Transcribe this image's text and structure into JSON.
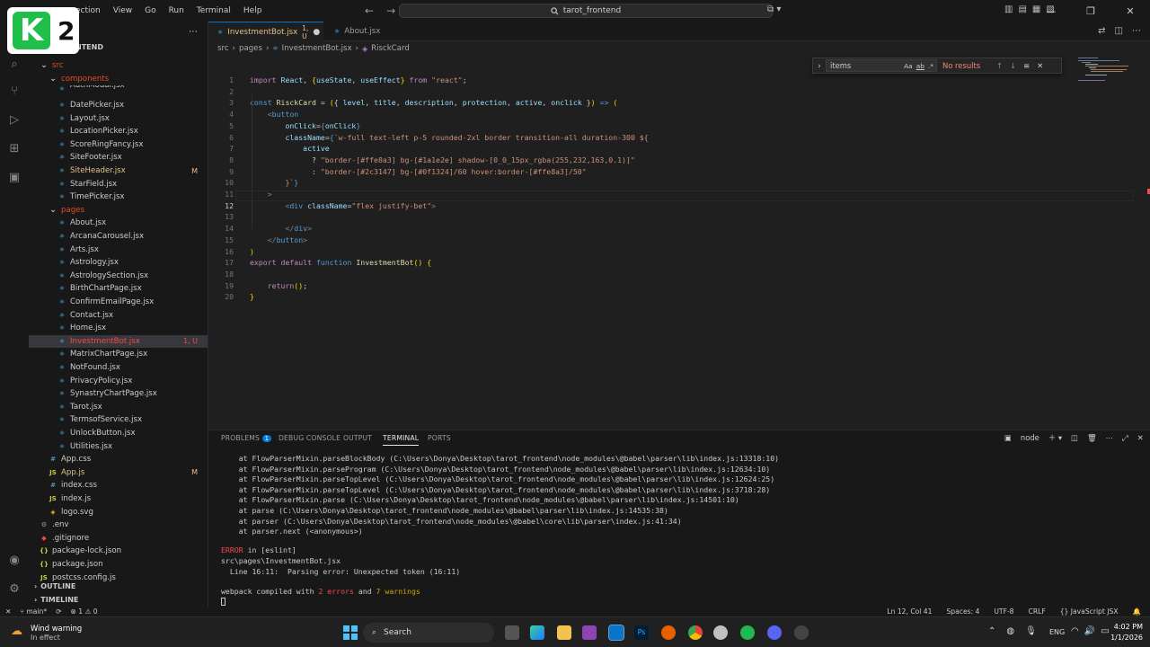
{
  "menu": [
    "ection",
    "View",
    "Go",
    "Run",
    "Terminal",
    "Help"
  ],
  "logo_text": "K",
  "logo_number": "2",
  "command_center": "tarot_frontend",
  "explorer": {
    "header": "NTEND",
    "rows": [
      {
        "label": "src",
        "type": "folder",
        "open": true,
        "indent": 1,
        "color": "#e34c26"
      },
      {
        "label": "components",
        "type": "folder",
        "open": true,
        "indent": 2,
        "color": "#e34c26"
      },
      {
        "label": "AuthModal.jsx",
        "type": "jsx",
        "indent": 3,
        "partial": true
      },
      {
        "label": "DatePicker.jsx",
        "type": "jsx",
        "indent": 3
      },
      {
        "label": "Layout.jsx",
        "type": "jsx",
        "indent": 3
      },
      {
        "label": "LocationPicker.jsx",
        "type": "jsx",
        "indent": 3
      },
      {
        "label": "ScoreRingFancy.jsx",
        "type": "jsx",
        "indent": 3
      },
      {
        "label": "SiteFooter.jsx",
        "type": "jsx",
        "indent": 3
      },
      {
        "label": "SiteHeader.jsx",
        "type": "jsx",
        "indent": 3,
        "status": "M",
        "modified": true
      },
      {
        "label": "StarField.jsx",
        "type": "jsx",
        "indent": 3
      },
      {
        "label": "TimePicker.jsx",
        "type": "jsx",
        "indent": 3
      },
      {
        "label": "pages",
        "type": "folder",
        "open": true,
        "indent": 2,
        "color": "#e34c26"
      },
      {
        "label": "About.jsx",
        "type": "jsx",
        "indent": 3
      },
      {
        "label": "ArcanaCarousel.jsx",
        "type": "jsx",
        "indent": 3
      },
      {
        "label": "Arts.jsx",
        "type": "jsx",
        "indent": 3
      },
      {
        "label": "Astrology.jsx",
        "type": "jsx",
        "indent": 3
      },
      {
        "label": "AstrologySection.jsx",
        "type": "jsx",
        "indent": 3
      },
      {
        "label": "BirthChartPage.jsx",
        "type": "jsx",
        "indent": 3
      },
      {
        "label": "ConfirmEmailPage.jsx",
        "type": "jsx",
        "indent": 3
      },
      {
        "label": "Contact.jsx",
        "type": "jsx",
        "indent": 3
      },
      {
        "label": "Home.jsx",
        "type": "jsx",
        "indent": 3
      },
      {
        "label": "InvestmentBot.jsx",
        "type": "jsx",
        "indent": 3,
        "status": "1, U",
        "error": true,
        "selected": true
      },
      {
        "label": "MatrixChartPage.jsx",
        "type": "jsx",
        "indent": 3
      },
      {
        "label": "NotFound.jsx",
        "type": "jsx",
        "indent": 3
      },
      {
        "label": "PrivacyPolicy.jsx",
        "type": "jsx",
        "indent": 3
      },
      {
        "label": "SynastryChartPage.jsx",
        "type": "jsx",
        "indent": 3
      },
      {
        "label": "Tarot.jsx",
        "type": "jsx",
        "indent": 3
      },
      {
        "label": "TermsofService.jsx",
        "type": "jsx",
        "indent": 3
      },
      {
        "label": "UnlockButton.jsx",
        "type": "jsx",
        "indent": 3
      },
      {
        "label": "Utilities.jsx",
        "type": "jsx",
        "indent": 3
      },
      {
        "label": "App.css",
        "type": "css",
        "indent": 2
      },
      {
        "label": "App.js",
        "type": "js",
        "indent": 2,
        "status": "M",
        "modified": true
      },
      {
        "label": "index.css",
        "type": "css",
        "indent": 2
      },
      {
        "label": "index.js",
        "type": "js",
        "indent": 2
      },
      {
        "label": "logo.svg",
        "type": "svg",
        "indent": 2
      },
      {
        "label": ".env",
        "type": "env",
        "indent": 1
      },
      {
        "label": ".gitignore",
        "type": "git",
        "indent": 1
      },
      {
        "label": "package-lock.json",
        "type": "json",
        "indent": 1
      },
      {
        "label": "package.json",
        "type": "json",
        "indent": 1
      },
      {
        "label": "postcss.config.js",
        "type": "js",
        "indent": 1
      }
    ],
    "outline": "OUTLINE",
    "timeline": "TIMELINE"
  },
  "tabs": [
    {
      "label": "InvestmentBot.jsx",
      "badge": "1, U",
      "active": true
    },
    {
      "label": "About.jsx",
      "badge": "",
      "active": false
    }
  ],
  "breadcrumb": [
    "src",
    "pages",
    "InvestmentBot.jsx",
    "RisckCard"
  ],
  "find": {
    "value": "items",
    "result": "No results",
    "opt1": "Aa",
    "opt2": "ab",
    "opt3": ".*"
  },
  "code_lines": [
    "<span class=\"kw2\">import</span> <span class=\"vr\">React</span>, <span class=\"br\">{</span><span class=\"vr\">useState</span>, <span class=\"vr\">useEffect</span><span class=\"br\">}</span> <span class=\"kw2\">from</span> <span class=\"st\">\"react\"</span>;",
    "",
    "<span class=\"kw\">const</span> <span class=\"fn\">RisckCard</span> = <span class=\"br\">(</span>{ <span class=\"vr\">level</span>, <span class=\"vr\">title</span>, <span class=\"vr\">description</span>, <span class=\"vr\">protection</span>, <span class=\"vr\">active</span>, <span class=\"vr\">onclick</span> }<span class=\"br\">)</span> <span class=\"kw\">=&gt;</span> <span class=\"br\">(</span>",
    "    <span class=\"tg\">&lt;</span><span class=\"tn\">button</span>",
    "        <span class=\"vr\">onClick</span>=<span class=\"kw\">{</span><span class=\"vr\">onClick</span><span class=\"kw\">}</span>",
    "        <span class=\"vr\">className</span>=<span class=\"kw\">{</span><span class=\"st\">`w-full text-left p-5 rounded-2xl border transition-all duration-300 ${</span>",
    "            <span class=\"vr\">active</span>",
    "              ? <span class=\"st\">\"border-[#ffe8a3] bg-[#1a1e2e] shadow-[0_0_15px_rgba(255,232,163,0.1)]\"</span>",
    "              : <span class=\"st\">\"border-[#2c3147] bg-[#0f1324]/60 hover:border-[#ffe8a3]/50\"</span>",
    "        <span class=\"st\">}`</span><span class=\"kw\">}</span>",
    "    <span class=\"tg\">&gt;</span>",
    "        <span class=\"tg\">&lt;</span><span class=\"tn\">div</span> <span class=\"vr\">className</span>=<span class=\"st\">\"flex justify-bet\"</span><span class=\"tg\">&gt;</span>",
    "",
    "        <span class=\"tg\">&lt;/</span><span class=\"tn\">div</span><span class=\"tg\">&gt;</span>",
    "    <span class=\"tg\">&lt;/</span><span class=\"tn\">button</span><span class=\"tg\">&gt;</span>",
    "<span class=\"br\">)</span>",
    "<span class=\"kw2\">export</span> <span class=\"kw2\">default</span> <span class=\"kw\">function</span> <span class=\"fn\">InvestmentBot</span><span class=\"br\">()</span> <span class=\"br\">{</span>",
    "",
    "    <span class=\"kw2\">return</span><span class=\"br\">()</span>;",
    "<span class=\"br\">}</span>"
  ],
  "panel": {
    "tabs": [
      "PROBLEMS",
      "DEBUG CONSOLE",
      "OUTPUT",
      "TERMINAL",
      "PORTS"
    ],
    "problems_count": "1",
    "active": "TERMINAL",
    "terminal_name": "node",
    "terminal_lines": [
      "    at FlowParserMixin.parseBlockBody (C:\\Users\\Donya\\Desktop\\tarot_frontend\\node_modules\\@babel\\parser\\lib\\index.js:13318:10)",
      "    at FlowParserMixin.parseProgram (C:\\Users\\Donya\\Desktop\\tarot_frontend\\node_modules\\@babel\\parser\\lib\\index.js:12634:10)",
      "    at FlowParserMixin.parseTopLevel (C:\\Users\\Donya\\Desktop\\tarot_frontend\\node_modules\\@babel\\parser\\lib\\index.js:12624:25)",
      "    at FlowParserMixin.parseTopLevel (C:\\Users\\Donya\\Desktop\\tarot_frontend\\node_modules\\@babel\\parser\\lib\\index.js:3718:28)",
      "    at FlowParserMixin.parse (C:\\Users\\Donya\\Desktop\\tarot_frontend\\node_modules\\@babel\\parser\\lib\\index.js:14501:10)",
      "    at parse (C:\\Users\\Donya\\Desktop\\tarot_frontend\\node_modules\\@babel\\parser\\lib\\index.js:14535:38)",
      "    at parser (C:\\Users\\Donya\\Desktop\\tarot_frontend\\node_modules\\@babel\\core\\lib\\parser\\index.js:41:34)",
      "    at parser.next (<anonymous>)"
    ],
    "error_label": "ERROR",
    "error_rest": " in [eslint]",
    "error_file": "src\\pages\\InvestmentBot.jsx",
    "error_line": "  Line 16:11:  Parsing error: Unexpected token (16:11)",
    "compiled_prefix": "webpack compiled with ",
    "compiled_errors": "2 errors",
    "compiled_mid": " and ",
    "compiled_warnings": "7 warnings"
  },
  "status": {
    "branch": "main*",
    "problems": "1",
    "warnings": "0",
    "position": "Ln 12, Col 41",
    "spaces": "Spaces: 4",
    "encoding": "UTF-8",
    "eol": "CRLF",
    "language": "JavaScript JSX"
  },
  "taskbar": {
    "weather_title": "Wind warning",
    "weather_sub": "In effect",
    "search": "Search",
    "lang": "ENG",
    "time": "4:02 PM",
    "date": "1/1/2026"
  },
  "colors": {
    "accent": "#0078d4",
    "error": "#f14c4c",
    "modified": "#e2c08d",
    "jsx": "#4fc1ff",
    "css": "#519aba",
    "json": "#cbcb41"
  }
}
